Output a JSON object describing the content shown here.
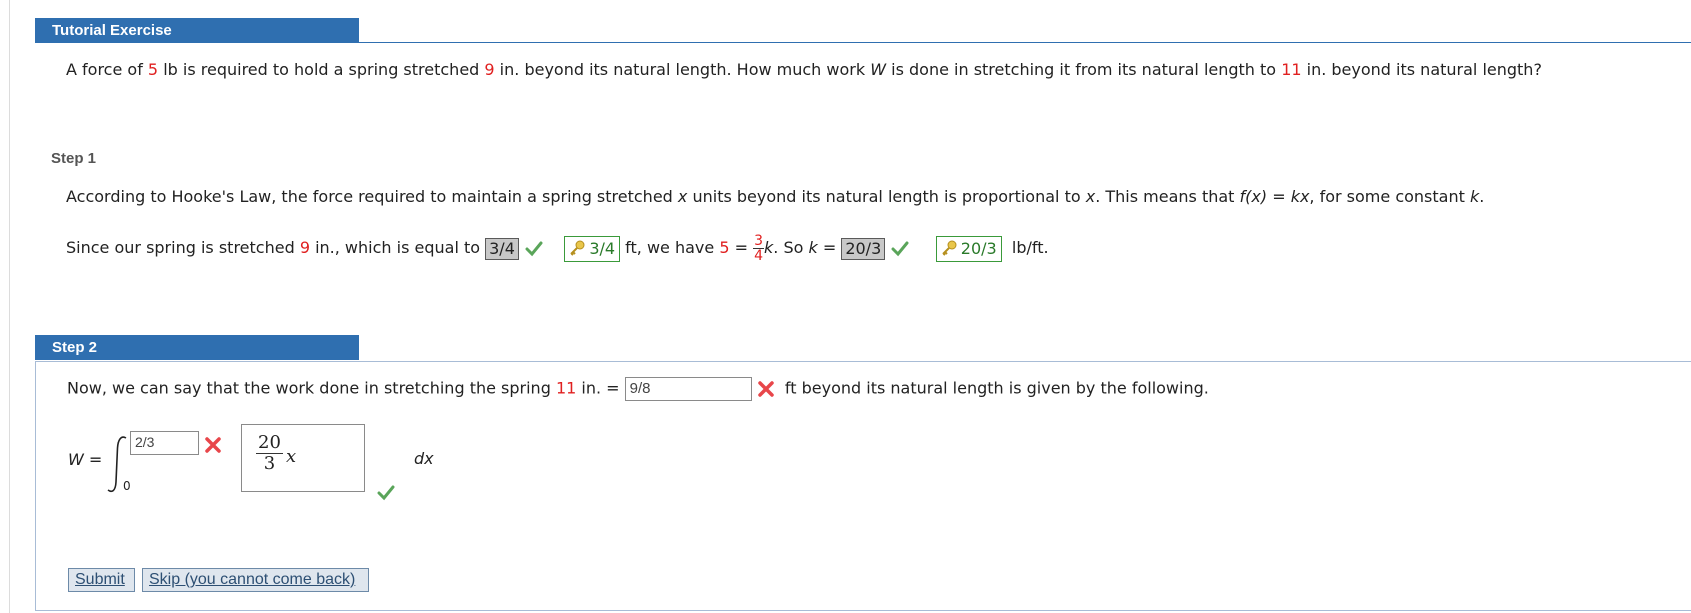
{
  "tutorial": {
    "header": "Tutorial Exercise",
    "problem": {
      "t1": "A force of ",
      "force": "5",
      "t2": " lb is required to hold a spring stretched ",
      "stretch": "9",
      "t3": " in. beyond its natural length. How much work ",
      "W": "W",
      "t4": " is done in stretching it from its natural length to ",
      "target": "11",
      "t5": " in. beyond its natural length?"
    }
  },
  "step1": {
    "label": "Step 1",
    "line1": {
      "t1": "According to Hooke's Law, the force required to maintain a spring stretched ",
      "x1": "x",
      "t2": " units beyond its natural length is proportional to ",
      "x2": "x",
      "t3": ". This means that ",
      "fx": "f(x)",
      "t4": " = ",
      "kx": "kx",
      "t5": ", for some constant ",
      "k": "k",
      "t6": "."
    },
    "line2": {
      "t1": "Since our spring is stretched ",
      "stretch": "9",
      "t2": " in., which is equal to ",
      "answer1": "3/4",
      "key1": "3/4",
      "t3": " ft, we have ",
      "force": "5",
      "t4": " = ",
      "frac_num": "3",
      "frac_den": "4",
      "k1": "k",
      "t5": ". So ",
      "k2": "k",
      "t6": " = ",
      "answer2": "20/3",
      "key2": "20/3",
      "t7": " lb/ft."
    }
  },
  "step2": {
    "label": "Step 2",
    "line1": {
      "t1": "Now, we can say that the work done in stretching the spring ",
      "target": "11",
      "t2": " in. = ",
      "input_value": "9/8",
      "t3": "ft beyond its natural length is given by the following."
    },
    "integral": {
      "lhs": "W =",
      "upper_value": "2/3",
      "lower": "0",
      "integrand_num": "20",
      "integrand_den": "3",
      "integrand_var": "x",
      "dx": "dx"
    },
    "submit_label": "Submit",
    "skip_label": "Skip (you cannot come back)"
  },
  "colors": {
    "header_blue": "#2f6fb0",
    "given_red": "#e02020",
    "correct_green": "#5aa55a",
    "wrong_red": "#e8464a"
  },
  "icons": [
    "check-icon",
    "key-icon",
    "x-mark-icon",
    "integral-icon"
  ]
}
